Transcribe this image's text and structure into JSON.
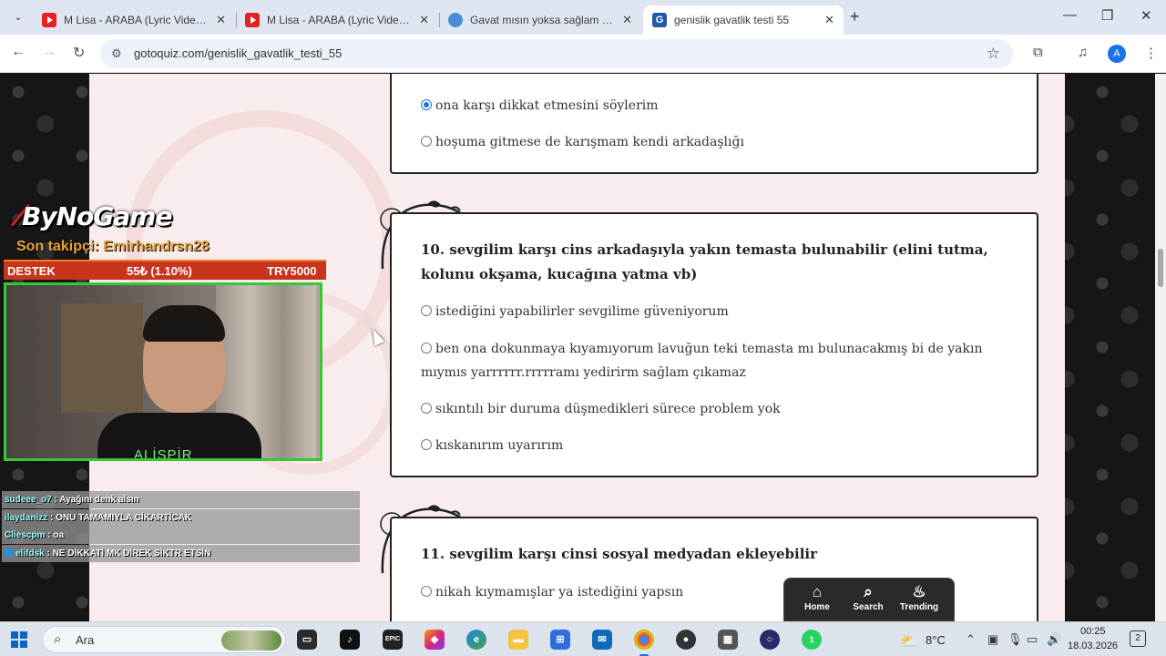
{
  "browser": {
    "tabs": [
      {
        "title": "M Lisa - ARABA (Lyric Video) - \\",
        "favicon": "youtube-icon"
      },
      {
        "title": "M Lisa - ARABA (Lyric Video) - \\",
        "favicon": "youtube-icon"
      },
      {
        "title": "Gavat mısın yoksa sağlam bir g",
        "favicon": "globe-icon"
      },
      {
        "title": "genislik gavatlik testi 55",
        "favicon": "gotoquiz-icon",
        "active": true
      }
    ],
    "url": "gotoquiz.com/genislik_gavatlik_testi_55",
    "profile_initial": "A"
  },
  "quiz": {
    "prev_card": {
      "options": [
        {
          "text": "ona karşı dikkat etmesini söylerim",
          "checked": true
        },
        {
          "text": "hoşuma gitmese de karışmam kendi arkadaşlığı",
          "checked": false
        }
      ]
    },
    "q10": {
      "title": "10. sevgilim karşı cins arkadaşıyla yakın temasta bulunabilir (elini tutma, kolunu okşama, kucağına yatma vb)",
      "options": [
        {
          "text": "istediğini yapabilirler sevgilime güveniyorum",
          "checked": false
        },
        {
          "text": "ben ona dokunmaya kıyamıyorum lavuğun teki temasta mı bulunacakmış bi de yakın mıymıs yarrrrrr.rrrrramı yedirirm sağlam çıkamaz",
          "checked": false
        },
        {
          "text": "sıkıntılı bir duruma düşmedikleri sürece problem yok",
          "checked": false
        },
        {
          "text": "kıskanırım uyarırım",
          "checked": false
        }
      ]
    },
    "q11": {
      "title": "11. sevgilim karşı cinsi sosyal medyadan ekleyebilir",
      "options": [
        {
          "text": "nikah kıymamışlar ya istediğini yapsın",
          "checked": false
        }
      ]
    },
    "nav": {
      "home": "Home",
      "search": "Search",
      "trending": "Trending"
    }
  },
  "overlay": {
    "logo": "ByNoGame",
    "last_follower": "Son takipçi: Emirhandrsn28",
    "destek_label": "DESTEK",
    "destek_progress": "55₺ (1.10%)",
    "destek_goal": "TRY5000",
    "cam_name": "ALİSPİR",
    "chat": [
      {
        "user": "sudeee_o7",
        "msg": " : Ayağını denk alsın",
        "badge": false
      },
      {
        "user": "ilaydanizz",
        "msg": " : ONU TAMAMIYLA CİKARTİCAK",
        "badge": false
      },
      {
        "user": "Cliescpm",
        "msg": " : oa",
        "badge": false
      },
      {
        "user": "elifdsk",
        "msg": " : NE DİKKATİ MK DİREK SİKTR ETSİN",
        "badge": true
      }
    ]
  },
  "taskbar": {
    "search_placeholder": "Ara",
    "temperature": "8°C",
    "time": "00:25",
    "date": "18.03.2026",
    "notification_count": "2",
    "whatsapp_badge": "1"
  }
}
